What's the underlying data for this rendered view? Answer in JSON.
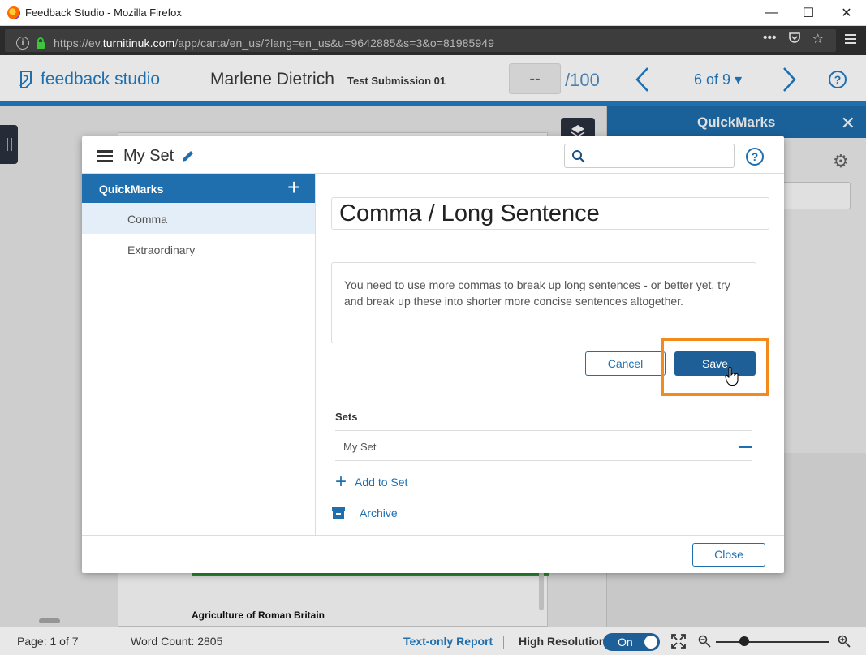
{
  "window": {
    "title": "Feedback Studio - Mozilla Firefox",
    "minimize": "—",
    "maximize": "☐",
    "close": "✕"
  },
  "urlbar": {
    "prefix": "https://ev.",
    "domain": "turnitinuk.com",
    "path": "/app/carta/en_us/?lang=en_us&u=9642885&s=3&o=81985949",
    "more": "•••",
    "bookmark": "☆"
  },
  "header": {
    "brand": "feedback studio",
    "student_name": "Marlene Dietrich",
    "submission_title": "Test Submission 01",
    "score": "--",
    "score_max": "/100",
    "paper_position": "6 of 9",
    "help": "?"
  },
  "document": {
    "heading": "Agriculture of Roman Britain"
  },
  "quickmarks_panel": {
    "title": "QuickMarks",
    "close": "✕",
    "gear": "⚙"
  },
  "modal": {
    "set_title": "My Set",
    "help": "?",
    "category": {
      "label": "QuickMarks",
      "add": "+"
    },
    "items": [
      {
        "label": "Comma",
        "selected": true
      },
      {
        "label": "Extraordinary",
        "selected": false
      }
    ],
    "editor": {
      "title_value": "Comma / Long Sentence",
      "comment": "You need to use more commas to break up long sentences - or better yet, try and break up these into shorter more concise sentences altogether.",
      "cancel_label": "Cancel",
      "save_label": "Save",
      "highlight_color": "#f28a1d"
    },
    "sets": {
      "label": "Sets",
      "rows": [
        {
          "label": "My Set"
        }
      ],
      "add_label": "Add to Set",
      "add_icon": "+",
      "archive_label": "Archive"
    },
    "close_label": "Close"
  },
  "statusbar": {
    "page": "Page: 1 of 7",
    "word_count": "Word Count: 2805",
    "text_only_report": "Text-only Report",
    "divider": "|",
    "high_resolution": "High Resolution",
    "toggle": "On",
    "zoom_level": 0.25
  },
  "colors": {
    "accent": "#1f6faf",
    "save_button": "#1f5f97",
    "highlight": "#f28a1d",
    "green_bar": "#2e9e3a"
  }
}
